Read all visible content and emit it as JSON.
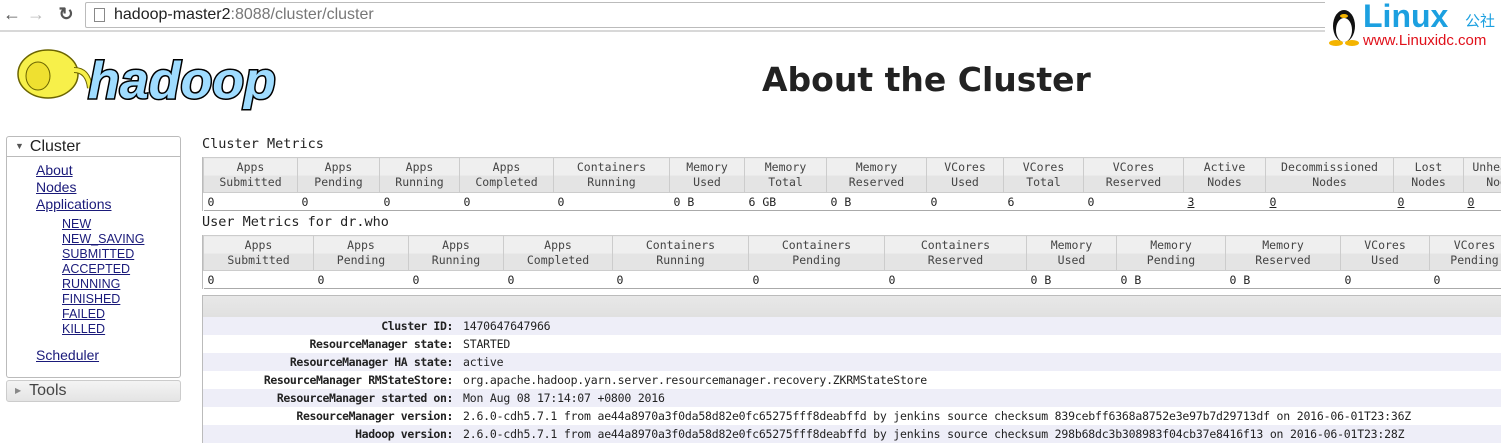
{
  "browser": {
    "url_host": "hadoop-master2",
    "url_rest": ":8088/cluster/cluster"
  },
  "watermark": {
    "brand": "Linux",
    "brand_cn": "公社",
    "site": "www.Linuxidc.com"
  },
  "logo_text": "hadoop",
  "page_title": "About the Cluster",
  "sidebar": {
    "cluster_label": "Cluster",
    "links": [
      "About",
      "Nodes",
      "Applications"
    ],
    "app_states": [
      "NEW",
      "NEW_SAVING",
      "SUBMITTED",
      "ACCEPTED",
      "RUNNING",
      "FINISHED",
      "FAILED",
      "KILLED"
    ],
    "scheduler": "Scheduler",
    "tools_label": "Tools"
  },
  "cluster_metrics": {
    "caption": "Cluster Metrics",
    "headers": [
      [
        "Apps",
        "Submitted"
      ],
      [
        "Apps",
        "Pending"
      ],
      [
        "Apps",
        "Running"
      ],
      [
        "Apps",
        "Completed"
      ],
      [
        "Containers",
        "Running"
      ],
      [
        "Memory",
        "Used"
      ],
      [
        "Memory",
        "Total"
      ],
      [
        "Memory",
        "Reserved"
      ],
      [
        "VCores",
        "Used"
      ],
      [
        "VCores",
        "Total"
      ],
      [
        "VCores",
        "Reserved"
      ],
      [
        "Active",
        "Nodes"
      ],
      [
        "Decommissioned",
        "Nodes"
      ],
      [
        "Lost",
        "Nodes"
      ],
      [
        "Unhealthy",
        "Nodes"
      ]
    ],
    "values": [
      "0",
      "0",
      "0",
      "0",
      "0",
      "0 B",
      "6 GB",
      "0 B",
      "0",
      "6",
      "0",
      "3",
      "0",
      "0",
      "0"
    ],
    "links": [
      false,
      false,
      false,
      false,
      false,
      false,
      false,
      false,
      false,
      false,
      false,
      true,
      true,
      true,
      true
    ]
  },
  "user_metrics": {
    "caption": "User Metrics for dr.who",
    "headers": [
      [
        "Apps",
        "Submitted"
      ],
      [
        "Apps",
        "Pending"
      ],
      [
        "Apps",
        "Running"
      ],
      [
        "Apps",
        "Completed"
      ],
      [
        "Containers",
        "Running"
      ],
      [
        "Containers",
        "Pending"
      ],
      [
        "Containers",
        "Reserved"
      ],
      [
        "Memory",
        "Used"
      ],
      [
        "Memory",
        "Pending"
      ],
      [
        "Memory",
        "Reserved"
      ],
      [
        "VCores",
        "Used"
      ],
      [
        "VCores",
        "Pending"
      ]
    ],
    "values": [
      "0",
      "0",
      "0",
      "0",
      "0",
      "0",
      "0",
      "0 B",
      "0 B",
      "0 B",
      "0",
      "0"
    ],
    "links": [
      false,
      false,
      false,
      false,
      false,
      false,
      false,
      false,
      false,
      false,
      false,
      false
    ]
  },
  "cluster_info": [
    {
      "key": "Cluster ID:",
      "value": "1470647647966"
    },
    {
      "key": "ResourceManager state:",
      "value": "STARTED"
    },
    {
      "key": "ResourceManager HA state:",
      "value": "active"
    },
    {
      "key": "ResourceManager RMStateStore:",
      "value": "org.apache.hadoop.yarn.server.resourcemanager.recovery.ZKRMStateStore"
    },
    {
      "key": "ResourceManager started on:",
      "value": "Mon Aug 08 17:14:07 +0800 2016"
    },
    {
      "key": "ResourceManager version:",
      "value": "2.6.0-cdh5.7.1 from ae44a8970a3f0da58d82e0fc65275fff8deabffd by jenkins source checksum 839cebff6368a8752e3e97b7d29713df on 2016-06-01T23:36Z"
    },
    {
      "key": "Hadoop version:",
      "value": "2.6.0-cdh5.7.1 from ae44a8970a3f0da58d82e0fc65275fff8deabffd by jenkins source checksum 298b68dc3b308983f04cb37e8416f13 on 2016-06-01T23:28Z"
    }
  ]
}
